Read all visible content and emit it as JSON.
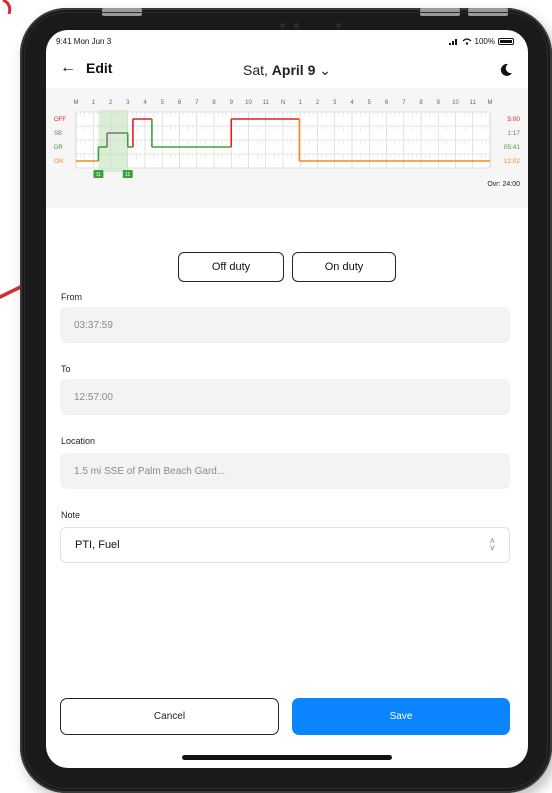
{
  "status_bar": {
    "time": "9:41 Mon Jun 3",
    "battery": "100%"
  },
  "nav": {
    "back_label": "Edit",
    "date_prefix": "Sat,",
    "date_main": "April 9"
  },
  "chart_data": {
    "type": "line",
    "x_ticks": [
      "M",
      "1",
      "2",
      "3",
      "4",
      "5",
      "6",
      "7",
      "8",
      "9",
      "10",
      "11",
      "N",
      "1",
      "2",
      "3",
      "4",
      "5",
      "6",
      "7",
      "8",
      "9",
      "10",
      "11",
      "M"
    ],
    "row_labels": [
      "OFF",
      "SB",
      "DR",
      "ON"
    ],
    "row_colors": [
      "#e02020",
      "#777777",
      "#3aa23a",
      "#f08a24"
    ],
    "totals": [
      "5:00",
      "1:17",
      "05:41",
      "12:02"
    ],
    "overall_total": "Ovr: 24:00",
    "segments": [
      {
        "status": "ON",
        "start": 0.0,
        "end": 1.3
      },
      {
        "status": "DR",
        "start": 1.3,
        "end": 1.8
      },
      {
        "status": "SB",
        "start": 1.8,
        "end": 3.0
      },
      {
        "status": "DR",
        "start": 3.0,
        "end": 3.3
      },
      {
        "status": "OFF",
        "start": 3.3,
        "end": 4.4
      },
      {
        "status": "DR",
        "start": 4.4,
        "end": 9.0
      },
      {
        "status": "OFF",
        "start": 9.0,
        "end": 12.95
      },
      {
        "status": "ON",
        "start": 12.95,
        "end": 24.0
      }
    ],
    "highlight": {
      "start": 1.3,
      "end": 3.0
    },
    "markers": [
      {
        "at": 1.3,
        "label": "11"
      },
      {
        "at": 3.0,
        "label": "11"
      }
    ]
  },
  "duty_buttons": {
    "off": "Off duty",
    "on": "On duty"
  },
  "form": {
    "from_label": "From",
    "from_value": "03:37:59",
    "to_label": "To",
    "to_value": "12:57:00",
    "location_label": "Location",
    "location_value": "1.5 mi SSE of Palm Beach Gard...",
    "note_label": "Note",
    "note_value": "PTI, Fuel"
  },
  "actions": {
    "cancel": "Cancel",
    "save": "Save"
  },
  "colors": {
    "accent": "#0a84ff",
    "annotation_arrow": "#d32f2f"
  }
}
